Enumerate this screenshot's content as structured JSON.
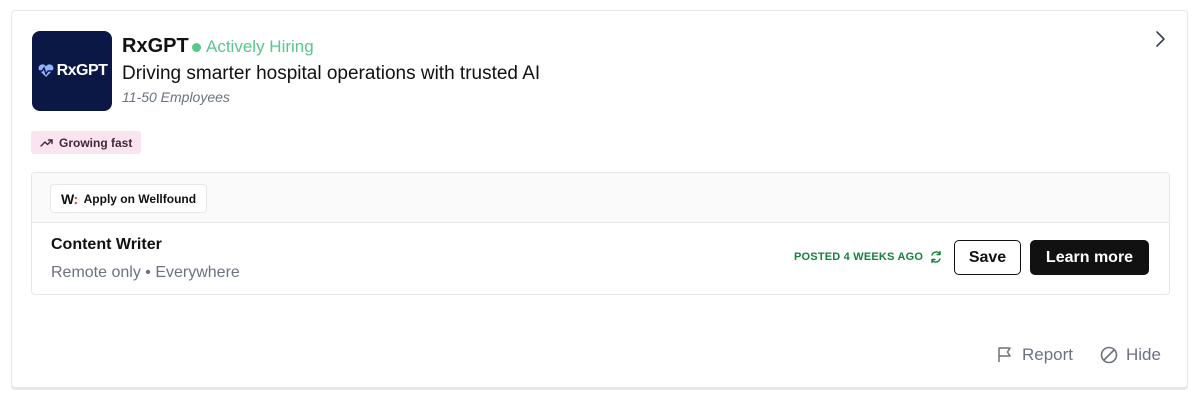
{
  "company": {
    "logo_text": "RxGPT",
    "name": "RxGPT",
    "status": "Actively Hiring",
    "tagline": "Driving smarter hospital operations with trusted AI",
    "employees": "11-50 Employees",
    "icon": "chevron-right-icon"
  },
  "badge": {
    "label": "Growing fast",
    "icon": "trending-up-icon",
    "color": "#fbe4ef"
  },
  "job": {
    "apply_label": "Apply on Wellfound",
    "apply_logo": "W",
    "apply_logo_dots": ":",
    "title": "Content Writer",
    "meta": "Remote only • Everywhere",
    "posted": "POSTED 4 WEEKS AGO",
    "posted_icon": "refresh-icon",
    "save_label": "Save",
    "learn_label": "Learn more"
  },
  "footer": {
    "report_label": "Report",
    "report_icon": "flag-icon",
    "hide_label": "Hide",
    "hide_icon": "block-icon"
  },
  "colors": {
    "hiring_green": "#55c88a",
    "posted_green": "#16803c",
    "logo_bg": "#0b1745",
    "button_dark": "#111111"
  }
}
